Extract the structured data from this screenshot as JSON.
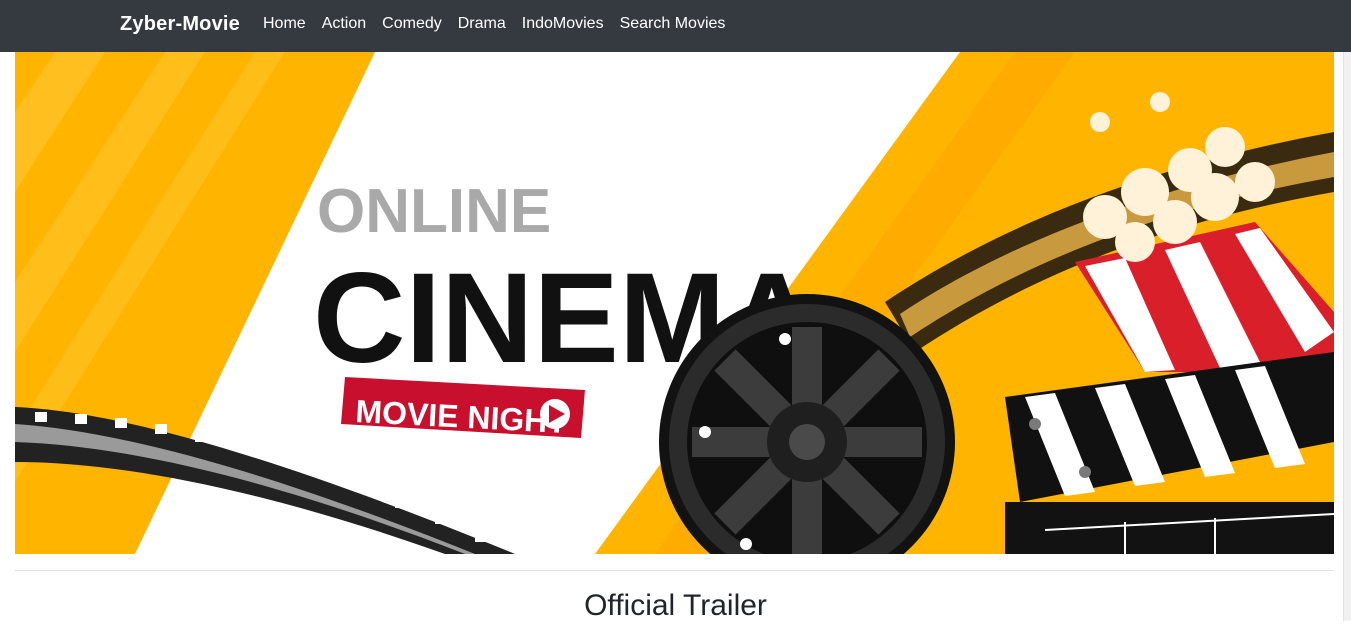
{
  "navbar": {
    "brand": "Zyber-Movie",
    "links": [
      "Home",
      "Action",
      "Comedy",
      "Drama",
      "IndoMovies",
      "Search Movies"
    ]
  },
  "hero": {
    "line1": "ONLINE",
    "line2": "CINEMA",
    "badge": "MOVIE NIGHT",
    "colors": {
      "yellow": "#ffb400",
      "red": "#c8102e",
      "dark": "#111111"
    }
  },
  "section": {
    "title": "Official Trailer"
  },
  "icons": {
    "play": "play-icon",
    "reel": "film-reel-icon",
    "clapper": "clapperboard-icon",
    "popcorn": "popcorn-icon",
    "filmstrip": "filmstrip-icon"
  }
}
